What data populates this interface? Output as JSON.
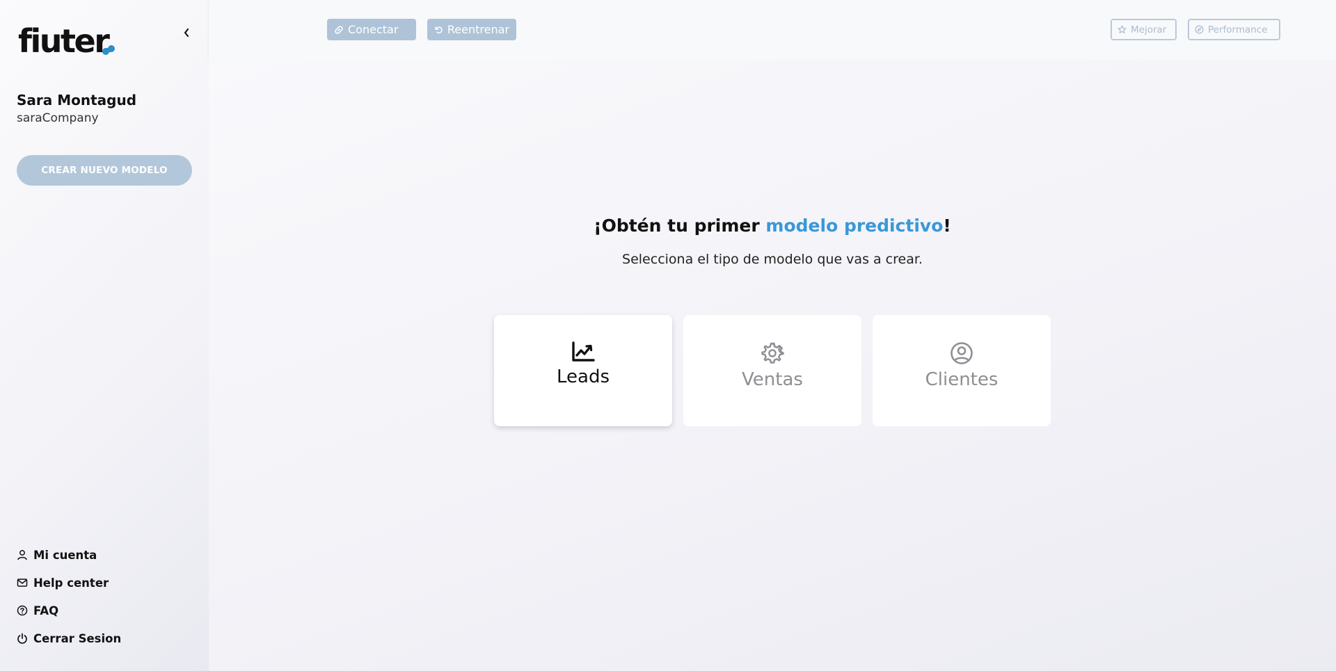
{
  "sidebar": {
    "logo_text": "fiuter",
    "user_name": "Sara Montagud",
    "company": "saraCompany",
    "create_button": "CREAR NUEVO MODELO",
    "nav": [
      {
        "label": "Mi cuenta",
        "icon": "user-icon"
      },
      {
        "label": "Help center",
        "icon": "mail-icon"
      },
      {
        "label": "FAQ",
        "icon": "help-circle-icon"
      },
      {
        "label": "Cerrar Sesion",
        "icon": "power-icon"
      }
    ]
  },
  "topbar": {
    "connect_label": "Conectar",
    "retrain_label": "Reentrenar",
    "improve_label": "Mejorar",
    "performance_label": "Performance"
  },
  "main": {
    "headline_prefix": "¡Obtén tu primer ",
    "headline_accent": "modelo predictivo",
    "headline_suffix": "!",
    "subtitle": "Selecciona el tipo de modelo que vas a crear.",
    "cards": [
      {
        "label": "Leads",
        "icon": "trending-up-icon",
        "active": true
      },
      {
        "label": "Ventas",
        "icon": "gear-icon",
        "active": false
      },
      {
        "label": "Clientes",
        "icon": "user-circle-icon",
        "active": false
      }
    ]
  },
  "colors": {
    "accent": "#3a98d6",
    "button_disabled": "#aec3d7",
    "logo_dot": "#2b8fc9"
  }
}
